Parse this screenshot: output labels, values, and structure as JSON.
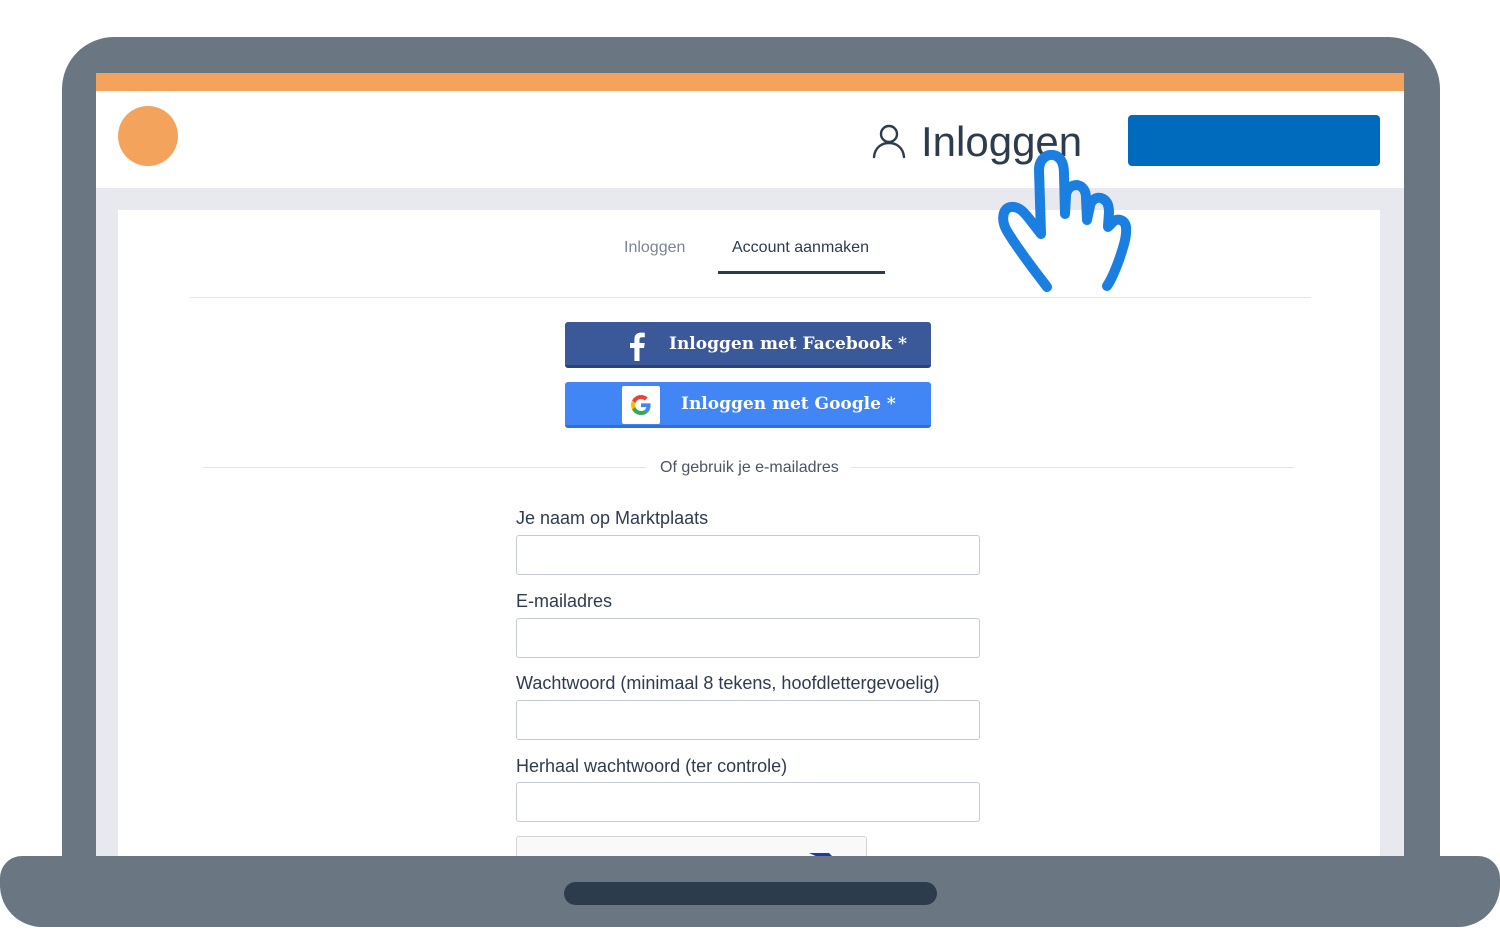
{
  "colors": {
    "accent_orange": "#f3a35c",
    "brand_blue": "#006bbd",
    "facebook_blue": "#3b5998",
    "google_blue": "#4285f4",
    "device_gray": "#6b7683",
    "pointer_blue": "#1a7fe0"
  },
  "header": {
    "logo_icon": "orange-circle-logo",
    "user_icon": "user-outline-icon",
    "login_label": "Inloggen",
    "primary_button_label": ""
  },
  "tabs": [
    {
      "label": "Inloggen",
      "active": false
    },
    {
      "label": "Account aanmaken",
      "active": true
    }
  ],
  "social": {
    "facebook_label": "Inloggen met Facebook *",
    "facebook_icon": "facebook-f-icon",
    "google_label": "Inloggen met Google *",
    "google_icon": "google-g-icon"
  },
  "divider_text": "Of gebruik je e-mailadres",
  "form": {
    "fields": [
      {
        "label": "Je naam op Marktplaats",
        "value": "",
        "placeholder": ""
      },
      {
        "label": "E-mailadres",
        "value": "",
        "placeholder": ""
      },
      {
        "label": "Wachtwoord (minimaal 8 tekens, hoofdlettergevoelig)",
        "value": "",
        "placeholder": ""
      },
      {
        "label": "Herhaal wachtwoord (ter controle)",
        "value": "",
        "placeholder": ""
      }
    ]
  },
  "overlay": {
    "pointer_icon": "pointing-hand-cursor-icon"
  }
}
